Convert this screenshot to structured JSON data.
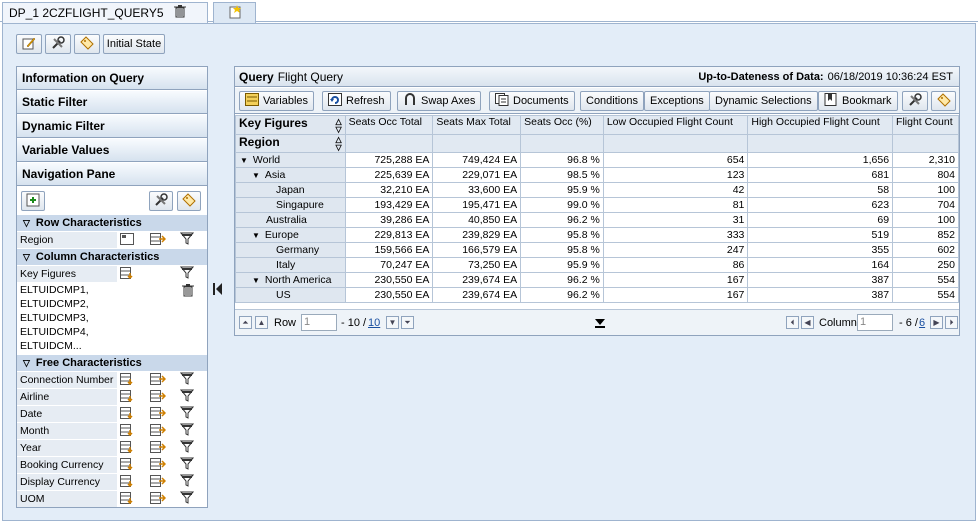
{
  "tabs": [
    {
      "label": "DP_1  2CZFLIGHT_QUERY5"
    }
  ],
  "toolbar": {
    "initial_state": "Initial State"
  },
  "left": {
    "accordion": [
      "Information on Query",
      "Static Filter",
      "Dynamic Filter",
      "Variable Values",
      "Navigation Pane"
    ],
    "row_char_title": "Row Characteristics",
    "row_chars": [
      "Region"
    ],
    "col_char_title": "Column Characteristics",
    "col_chars": [
      "Key Figures"
    ],
    "col_extra": [
      "ELTUIDCMP1,",
      "ELTUIDCMP2,",
      "ELTUIDCMP3,",
      "ELTUIDCMP4,",
      "ELTUIDCM..."
    ],
    "free_char_title": "Free Characteristics",
    "free_chars": [
      "Connection Number",
      "Airline",
      "Date",
      "Month",
      "Year",
      "Booking Currency",
      "Display Currency",
      "UOM"
    ]
  },
  "query": {
    "label": "Query",
    "name": "Flight Query",
    "up_label": "Up-to-Dateness of Data:",
    "up_value": "06/18/2019 10:36:24 EST"
  },
  "qtoolbar": {
    "variables": "Variables",
    "refresh": "Refresh",
    "swap": "Swap Axes",
    "documents": "Documents",
    "conditions": "Conditions",
    "exceptions": "Exceptions",
    "dynsel": "Dynamic Selections",
    "bookmark": "Bookmark"
  },
  "grid": {
    "key_figures": "Key Figures",
    "region": "Region",
    "columns": [
      "Seats Occ Total",
      "Seats Max Total",
      "Seats Occ (%)",
      "Low Occupied Flight Count",
      "High Occupied Flight Count",
      "Flight Count"
    ],
    "rows": [
      {
        "label": "World",
        "level": 0,
        "exp": true,
        "cells": [
          "725,288 EA",
          "749,424 EA",
          "96.8 %",
          "654",
          "1,656",
          "2,310"
        ]
      },
      {
        "label": "Asia",
        "level": 1,
        "exp": true,
        "cells": [
          "225,639 EA",
          "229,071 EA",
          "98.5 %",
          "123",
          "681",
          "804"
        ]
      },
      {
        "label": "Japan",
        "level": 2,
        "exp": false,
        "cells": [
          "32,210 EA",
          "33,600 EA",
          "95.9 %",
          "42",
          "58",
          "100"
        ]
      },
      {
        "label": "Singapure",
        "level": 2,
        "exp": false,
        "cells": [
          "193,429 EA",
          "195,471 EA",
          "99.0 %",
          "81",
          "623",
          "704"
        ]
      },
      {
        "label": "Australia",
        "level": 1,
        "exp": false,
        "cells": [
          "39,286 EA",
          "40,850 EA",
          "96.2 %",
          "31",
          "69",
          "100"
        ]
      },
      {
        "label": "Europe",
        "level": 1,
        "exp": true,
        "cells": [
          "229,813 EA",
          "239,829 EA",
          "95.8 %",
          "333",
          "519",
          "852"
        ]
      },
      {
        "label": "Germany",
        "level": 2,
        "exp": false,
        "cells": [
          "159,566 EA",
          "166,579 EA",
          "95.8 %",
          "247",
          "355",
          "602"
        ]
      },
      {
        "label": "Italy",
        "level": 2,
        "exp": false,
        "cells": [
          "70,247 EA",
          "73,250 EA",
          "95.9 %",
          "86",
          "164",
          "250"
        ]
      },
      {
        "label": "North America",
        "level": 1,
        "exp": true,
        "cells": [
          "230,550 EA",
          "239,674 EA",
          "96.2 %",
          "167",
          "387",
          "554"
        ]
      },
      {
        "label": "US",
        "level": 2,
        "exp": false,
        "cells": [
          "230,550 EA",
          "239,674 EA",
          "96.2 %",
          "167",
          "387",
          "554"
        ]
      }
    ]
  },
  "nav": {
    "row_label": "Row",
    "row_value": "1",
    "row_range": "- 10 /",
    "row_total": "10",
    "col_label": "Column",
    "col_value": "1",
    "col_range": "- 6 /",
    "col_total": "6"
  }
}
